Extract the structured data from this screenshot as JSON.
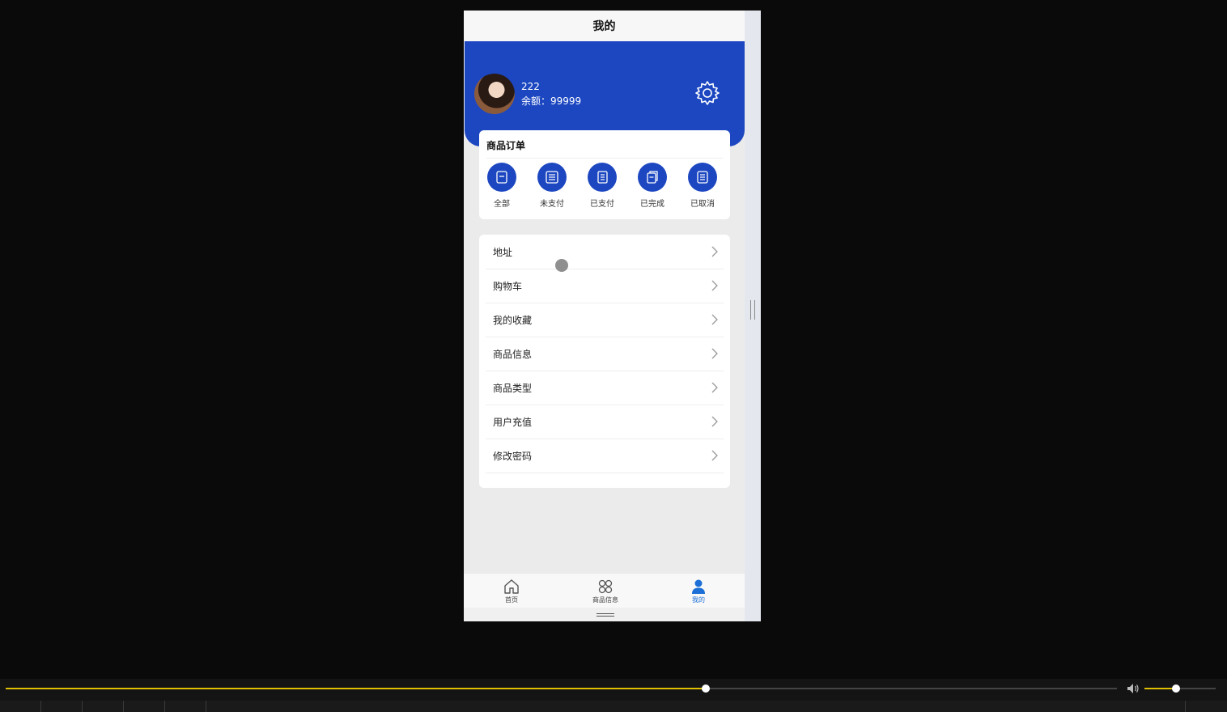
{
  "page": {
    "title": "我的"
  },
  "profile": {
    "username": "222",
    "balance": "余额：99999"
  },
  "orders": {
    "title": "商品订单",
    "items": [
      {
        "label": "全部",
        "icon": "order-all-icon"
      },
      {
        "label": "未支付",
        "icon": "order-unpaid-icon"
      },
      {
        "label": "已支付",
        "icon": "order-paid-icon"
      },
      {
        "label": "已完成",
        "icon": "order-done-icon"
      },
      {
        "label": "已取消",
        "icon": "order-cancel-icon"
      }
    ]
  },
  "menu": {
    "items": [
      {
        "label": "地址"
      },
      {
        "label": "购物车"
      },
      {
        "label": "我的收藏"
      },
      {
        "label": "商品信息"
      },
      {
        "label": "商品类型"
      },
      {
        "label": "用户充值"
      },
      {
        "label": "修改密码"
      }
    ]
  },
  "tabbar": {
    "items": [
      {
        "label": "首页",
        "icon": "home-icon"
      },
      {
        "label": "商品信息",
        "icon": "grid-icon"
      },
      {
        "label": "我的",
        "icon": "user-icon",
        "active": true
      }
    ]
  },
  "player": {
    "progress": 0.63,
    "volume": 0.44
  },
  "colors": {
    "brand": "#1c47c1",
    "active_tab": "#1c6fd6",
    "progress": "#e0c000"
  }
}
